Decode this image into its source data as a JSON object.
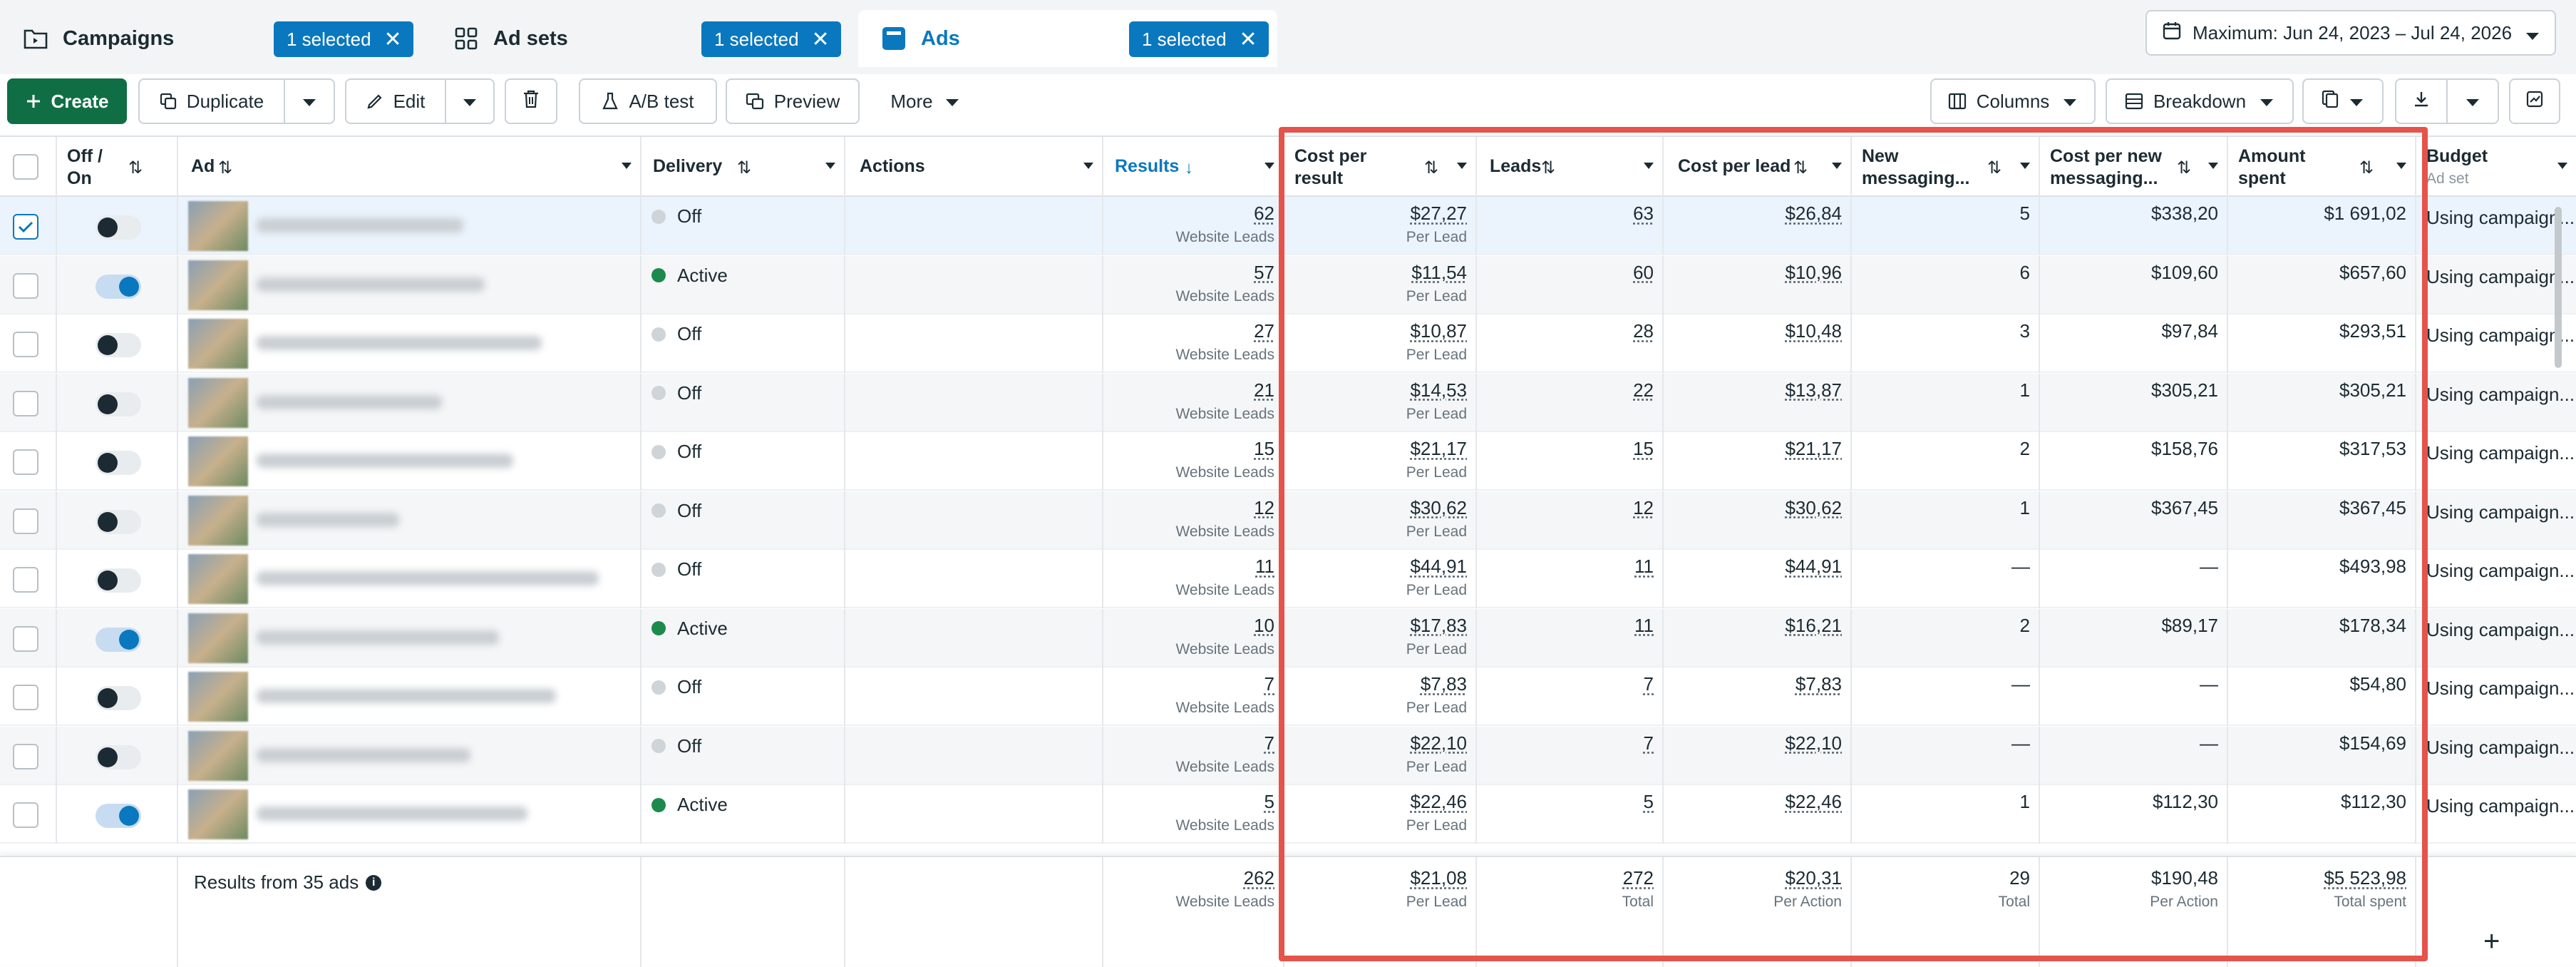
{
  "tabs": [
    {
      "label": "Campaigns",
      "badge": "1 selected"
    },
    {
      "label": "Ad sets",
      "badge": "1 selected"
    },
    {
      "label": "Ads",
      "badge": "1 selected"
    }
  ],
  "date_range": "Maximum: Jun 24, 2023 – Jul 24, 2026",
  "toolbar": {
    "create": "Create",
    "duplicate": "Duplicate",
    "edit": "Edit",
    "ab_test": "A/B test",
    "preview": "Preview",
    "more": "More",
    "columns": "Columns",
    "breakdown": "Breakdown"
  },
  "headers": {
    "off_on": "Off / On",
    "ad": "Ad",
    "delivery": "Delivery",
    "actions": "Actions",
    "results": "Results",
    "cost_per_result": "Cost per result",
    "leads": "Leads",
    "cost_per_lead": "Cost per lead",
    "new_messaging": "New messaging...",
    "cost_per_new_messaging": "Cost per new messaging...",
    "amount_spent": "Amount spent",
    "budget": "Budget",
    "budget_sub": "Ad set"
  },
  "rows": [
    {
      "on": false,
      "status": "Off",
      "active": false,
      "results": "62",
      "results_sub": "Website Leads",
      "cpr": "$27,27",
      "cpr_sub": "Per Lead",
      "leads": "63",
      "cpl": "$26,84",
      "new_msg": "5",
      "cost_new_msg": "$338,20",
      "spent": "$1 691,02",
      "budget": "Using campaign..."
    },
    {
      "on": true,
      "status": "Active",
      "active": true,
      "results": "57",
      "results_sub": "Website Leads",
      "cpr": "$11,54",
      "cpr_sub": "Per Lead",
      "leads": "60",
      "cpl": "$10,96",
      "new_msg": "6",
      "cost_new_msg": "$109,60",
      "spent": "$657,60",
      "budget": "Using campaign..."
    },
    {
      "on": false,
      "status": "Off",
      "active": false,
      "results": "27",
      "results_sub": "Website Leads",
      "cpr": "$10,87",
      "cpr_sub": "Per Lead",
      "leads": "28",
      "cpl": "$10,48",
      "new_msg": "3",
      "cost_new_msg": "$97,84",
      "spent": "$293,51",
      "budget": "Using campaign..."
    },
    {
      "on": false,
      "status": "Off",
      "active": false,
      "results": "21",
      "results_sub": "Website Leads",
      "cpr": "$14,53",
      "cpr_sub": "Per Lead",
      "leads": "22",
      "cpl": "$13,87",
      "new_msg": "1",
      "cost_new_msg": "$305,21",
      "spent": "$305,21",
      "budget": "Using campaign..."
    },
    {
      "on": false,
      "status": "Off",
      "active": false,
      "results": "15",
      "results_sub": "Website Leads",
      "cpr": "$21,17",
      "cpr_sub": "Per Lead",
      "leads": "15",
      "cpl": "$21,17",
      "new_msg": "2",
      "cost_new_msg": "$158,76",
      "spent": "$317,53",
      "budget": "Using campaign..."
    },
    {
      "on": false,
      "status": "Off",
      "active": false,
      "results": "12",
      "results_sub": "Website Leads",
      "cpr": "$30,62",
      "cpr_sub": "Per Lead",
      "leads": "12",
      "cpl": "$30,62",
      "new_msg": "1",
      "cost_new_msg": "$367,45",
      "spent": "$367,45",
      "budget": "Using campaign..."
    },
    {
      "on": false,
      "status": "Off",
      "active": false,
      "results": "11",
      "results_sub": "Website Leads",
      "cpr": "$44,91",
      "cpr_sub": "Per Lead",
      "leads": "11",
      "cpl": "$44,91",
      "new_msg": "—",
      "cost_new_msg": "—",
      "spent": "$493,98",
      "budget": "Using campaign..."
    },
    {
      "on": true,
      "status": "Active",
      "active": true,
      "results": "10",
      "results_sub": "Website Leads",
      "cpr": "$17,83",
      "cpr_sub": "Per Lead",
      "leads": "11",
      "cpl": "$16,21",
      "new_msg": "2",
      "cost_new_msg": "$89,17",
      "spent": "$178,34",
      "budget": "Using campaign..."
    },
    {
      "on": false,
      "status": "Off",
      "active": false,
      "results": "7",
      "results_sub": "Website Leads",
      "cpr": "$7,83",
      "cpr_sub": "Per Lead",
      "leads": "7",
      "cpl": "$7,83",
      "new_msg": "—",
      "cost_new_msg": "—",
      "spent": "$54,80",
      "budget": "Using campaign..."
    },
    {
      "on": false,
      "status": "Off",
      "active": false,
      "results": "7",
      "results_sub": "Website Leads",
      "cpr": "$22,10",
      "cpr_sub": "Per Lead",
      "leads": "7",
      "cpl": "$22,10",
      "new_msg": "—",
      "cost_new_msg": "—",
      "spent": "$154,69",
      "budget": "Using campaign..."
    },
    {
      "on": true,
      "status": "Active",
      "active": true,
      "results": "5",
      "results_sub": "Website Leads",
      "cpr": "$22,46",
      "cpr_sub": "Per Lead",
      "leads": "5",
      "cpl": "$22,46",
      "new_msg": "1",
      "cost_new_msg": "$112,30",
      "spent": "$112,30",
      "budget": "Using campaign..."
    }
  ],
  "summary": {
    "label": "Results from 35 ads",
    "results": "262",
    "results_sub": "Website Leads",
    "cpr": "$21,08",
    "cpr_sub": "Per Lead",
    "leads": "272",
    "leads_sub": "Total",
    "cpl": "$20,31",
    "cpl_sub": "Per Action",
    "new_msg": "29",
    "new_msg_sub": "Total",
    "cost_new_msg": "$190,48",
    "cost_new_msg_sub": "Per Action",
    "spent": "$5 523,98",
    "spent_sub": "Total spent"
  },
  "colors": {
    "accent": "#0a78be",
    "create": "#0f6e44",
    "highlight": "#e5534b",
    "active_dot": "#1d8a4d"
  }
}
